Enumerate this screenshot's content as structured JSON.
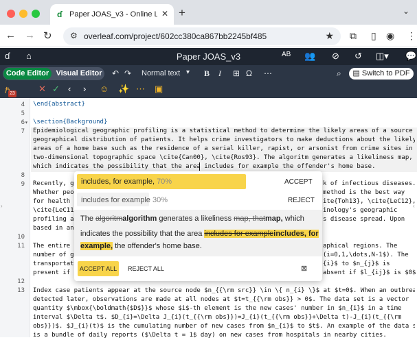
{
  "browser": {
    "tab_title": "Paper JOAS_v3 - Online LaTe",
    "tab_icon": "overleaf-leaf-icon",
    "url": "overleaf.com/project/602cc380ca867bb2245bf485",
    "colors": {
      "close": "#ff5f57",
      "minimize": "#febc2e",
      "maximize": "#28c840"
    }
  },
  "overleaf": {
    "project_title": "Paper JOAS_v3",
    "toolbar": {
      "code_editor": "Code Editor",
      "visual_editor": "Visual Editor",
      "text_style": "Normal text",
      "switch_pdf": "Switch to PDF"
    },
    "writefull": {
      "count": "23"
    },
    "brand_color": "#098842"
  },
  "editor": {
    "lines": [
      {
        "n": "4",
        "parts": [
          {
            "t": "\\end{abstract}",
            "c": "kw"
          }
        ]
      },
      {
        "n": "5",
        "parts": []
      },
      {
        "n": "6",
        "fold": true,
        "parts": [
          {
            "t": "\\section{Background}",
            "c": "kw"
          }
        ]
      },
      {
        "n": "7",
        "parts": []
      },
      {
        "n": "8",
        "parts": []
      },
      {
        "n": "9",
        "parts": []
      },
      {
        "n": "10",
        "parts": []
      },
      {
        "n": "11",
        "parts": []
      },
      {
        "n": "12",
        "parts": []
      },
      {
        "n": "13",
        "parts": []
      }
    ],
    "l7": [
      "Epidemiological geographic profiling is a statistical method to determine the likely areas of a source from",
      "geographical distribution of patients. It helps crime investigators to make deductions about the likely",
      "areas of a home base such as the residence of a serial killer, rapist, or arsonist from crime sites in a",
      "two-dimensional topographic space \\cite{Can00}, \\cite{Ros93}. The algoritm generates a likeliness map, that",
      "which indicates the possibility that the area includes for example the offender's home base."
    ],
    "l9": [
      "Recently, ge",
      "Whether peop",
      "for health r",
      "\\cite{LeC11}",
      "profiling al",
      "based in an"
    ],
    "l9_right": [
      "k of infectious diseases.",
      "method is the best way",
      "ite{Toh13}, \\cite{LeC12},",
      "inology's geographic",
      "s disease spread. Upon",
      ""
    ],
    "l11": [
      "The entire p",
      "number of ge",
      "transportat",
      "present if t"
    ],
    "l11_right": [
      "aphical regions. The",
      "(i=0,1,\\dots,N-1$). The",
      "{i}$ to $n_{j}$ is",
      "absent if $l_{ij}$ is $0$."
    ],
    "l13": [
      "Index case patients appear at the source node $n_{{\\rm src}} \\in \\{ n_{i} \\}$ at $t=0$. When an outbreak is",
      "detected later, observations are made at all nodes at $t=t_{{\\rm obs}} > 0$. The data set is a vector",
      "quantity $\\mbox{\\boldmath{$D$}}$ whose $i$-th element is the new cases' number in $n_{i}$ in a time",
      "interval $\\Delta t$. $D_{i}=\\Delta J_{i}(t_{{\\rm obs}})=J_{i}(t_{{\\rm obs}}+\\Delta t)-J_{i}(t_{{\\rm",
      "obs}})$. $J_{i}(t)$ is the cumulating number of new cases from $n_{i}$ to $t$. An example of the data set",
      "is a bundle of daily reports ($\\Delta t = 1$ day) on new cases from hospitals in nearby cities."
    ]
  },
  "suggestion": {
    "option1": {
      "text": "includes, for example,",
      "pct": "70%"
    },
    "option2": {
      "text": "includes for example",
      "pct": "30%"
    },
    "accept": "ACCEPT",
    "reject": "REJECT",
    "preview": {
      "p1": "The ",
      "del1": "algoritm",
      "ins1": "algorithm",
      "p2": " generates a likeliness ",
      "del2": "map, that",
      "ins2": "map,",
      "p3": " which",
      "p4": "indicates the possibility that the area ",
      "del3": "includes for example",
      "ins3": "includes, for",
      "ins3b": "example,",
      "p5": " the offender's home base."
    },
    "accept_all": "ACCEPT ALL",
    "reject_all": "REJECT ALL",
    "highlight_color": "#f8d44a"
  }
}
